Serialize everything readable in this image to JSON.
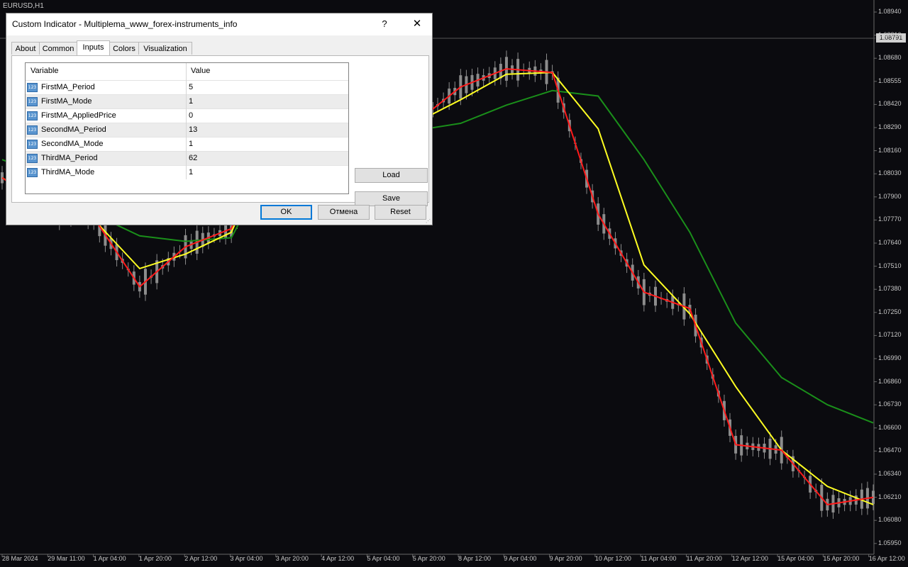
{
  "chart": {
    "symbol": "EURUSD,H1",
    "current_price": "1.08791",
    "price_labels": [
      "1.08940",
      "1.08810",
      "1.08680",
      "1.08555",
      "1.08420",
      "1.08290",
      "1.08160",
      "1.08030",
      "1.07900",
      "1.07770",
      "1.07640",
      "1.07510",
      "1.07380",
      "1.07250",
      "1.07120",
      "1.06990",
      "1.06860",
      "1.06730",
      "1.06600",
      "1.06470",
      "1.06340",
      "1.06210",
      "1.06080",
      "1.05950"
    ],
    "time_labels": [
      "28 Mar 2024",
      "29 Mar 11:00",
      "1 Apr 04:00",
      "1 Apr 20:00",
      "2 Apr 12:00",
      "3 Apr 04:00",
      "3 Apr 20:00",
      "4 Apr 12:00",
      "5 Apr 04:00",
      "5 Apr 20:00",
      "8 Apr 12:00",
      "9 Apr 04:00",
      "9 Apr 20:00",
      "10 Apr 12:00",
      "11 Apr 04:00",
      "11 Apr 20:00",
      "12 Apr 12:00",
      "15 Apr 04:00",
      "15 Apr 20:00",
      "16 Apr 12:00"
    ],
    "colors": {
      "background": "#0b0b0f",
      "candles": "#8c8c8c",
      "first_ma": "#ff1a1a",
      "second_ma": "#ffff22",
      "third_ma": "#1a8f1a"
    }
  },
  "chart_data": {
    "type": "line",
    "title": "",
    "ylim": [
      1.0595,
      1.0894
    ],
    "x": [
      "28 Mar 2024",
      "29 Mar 11:00",
      "1 Apr 04:00",
      "1 Apr 20:00",
      "2 Apr 12:00",
      "3 Apr 04:00",
      "3 Apr 20:00",
      "4 Apr 12:00",
      "5 Apr 04:00",
      "5 Apr 20:00",
      "8 Apr 12:00",
      "9 Apr 04:00",
      "9 Apr 20:00",
      "10 Apr 12:00",
      "11 Apr 04:00",
      "11 Apr 20:00",
      "12 Apr 12:00",
      "15 Apr 04:00",
      "15 Apr 20:00",
      "16 Apr 12:00"
    ],
    "series": [
      {
        "values": [
          1.08,
          1.0783,
          1.0778,
          1.074,
          1.0762,
          1.0772,
          1.0835,
          1.0838,
          1.0839,
          1.083,
          1.085,
          1.086,
          1.0858,
          1.078,
          1.0737,
          1.0728,
          1.0653,
          1.065,
          1.062,
          1.0624
        ]
      },
      {
        "values": [
          1.08,
          1.0785,
          1.0777,
          1.075,
          1.0758,
          1.077,
          1.0828,
          1.0836,
          1.0836,
          1.083,
          1.0843,
          1.0857,
          1.0858,
          1.0827,
          1.0752,
          1.0725,
          1.0685,
          1.065,
          1.063,
          1.062
        ]
      },
      {
        "values": [
          1.081,
          1.08,
          1.078,
          1.0768,
          1.0765,
          1.0767,
          1.0815,
          1.0822,
          1.0826,
          1.0826,
          1.083,
          1.084,
          1.0848,
          1.0845,
          1.081,
          1.077,
          1.072,
          1.069,
          1.0675,
          1.0665
        ]
      }
    ]
  },
  "dialog": {
    "title": "Custom Indicator - Multiplema_www_forex-instruments_info",
    "help": "?",
    "close": "✕",
    "tabs": [
      "About",
      "Common",
      "Inputs",
      "Colors",
      "Visualization"
    ],
    "active_tab": "Inputs",
    "grid": {
      "col_variable": "Variable",
      "col_value": "Value",
      "rows": [
        {
          "name": "FirstMA_Period",
          "value": "5"
        },
        {
          "name": "FirstMA_Mode",
          "value": "1"
        },
        {
          "name": "FirstMA_AppliedPrice",
          "value": "0"
        },
        {
          "name": "SecondMA_Period",
          "value": "13"
        },
        {
          "name": "SecondMA_Mode",
          "value": "1"
        },
        {
          "name": "ThirdMA_Period",
          "value": "62"
        },
        {
          "name": "ThirdMA_Mode",
          "value": "1"
        }
      ],
      "row_icon": "123"
    },
    "load": "Load",
    "save": "Save",
    "ok": "OK",
    "cancel": "Отмена",
    "reset": "Reset"
  }
}
